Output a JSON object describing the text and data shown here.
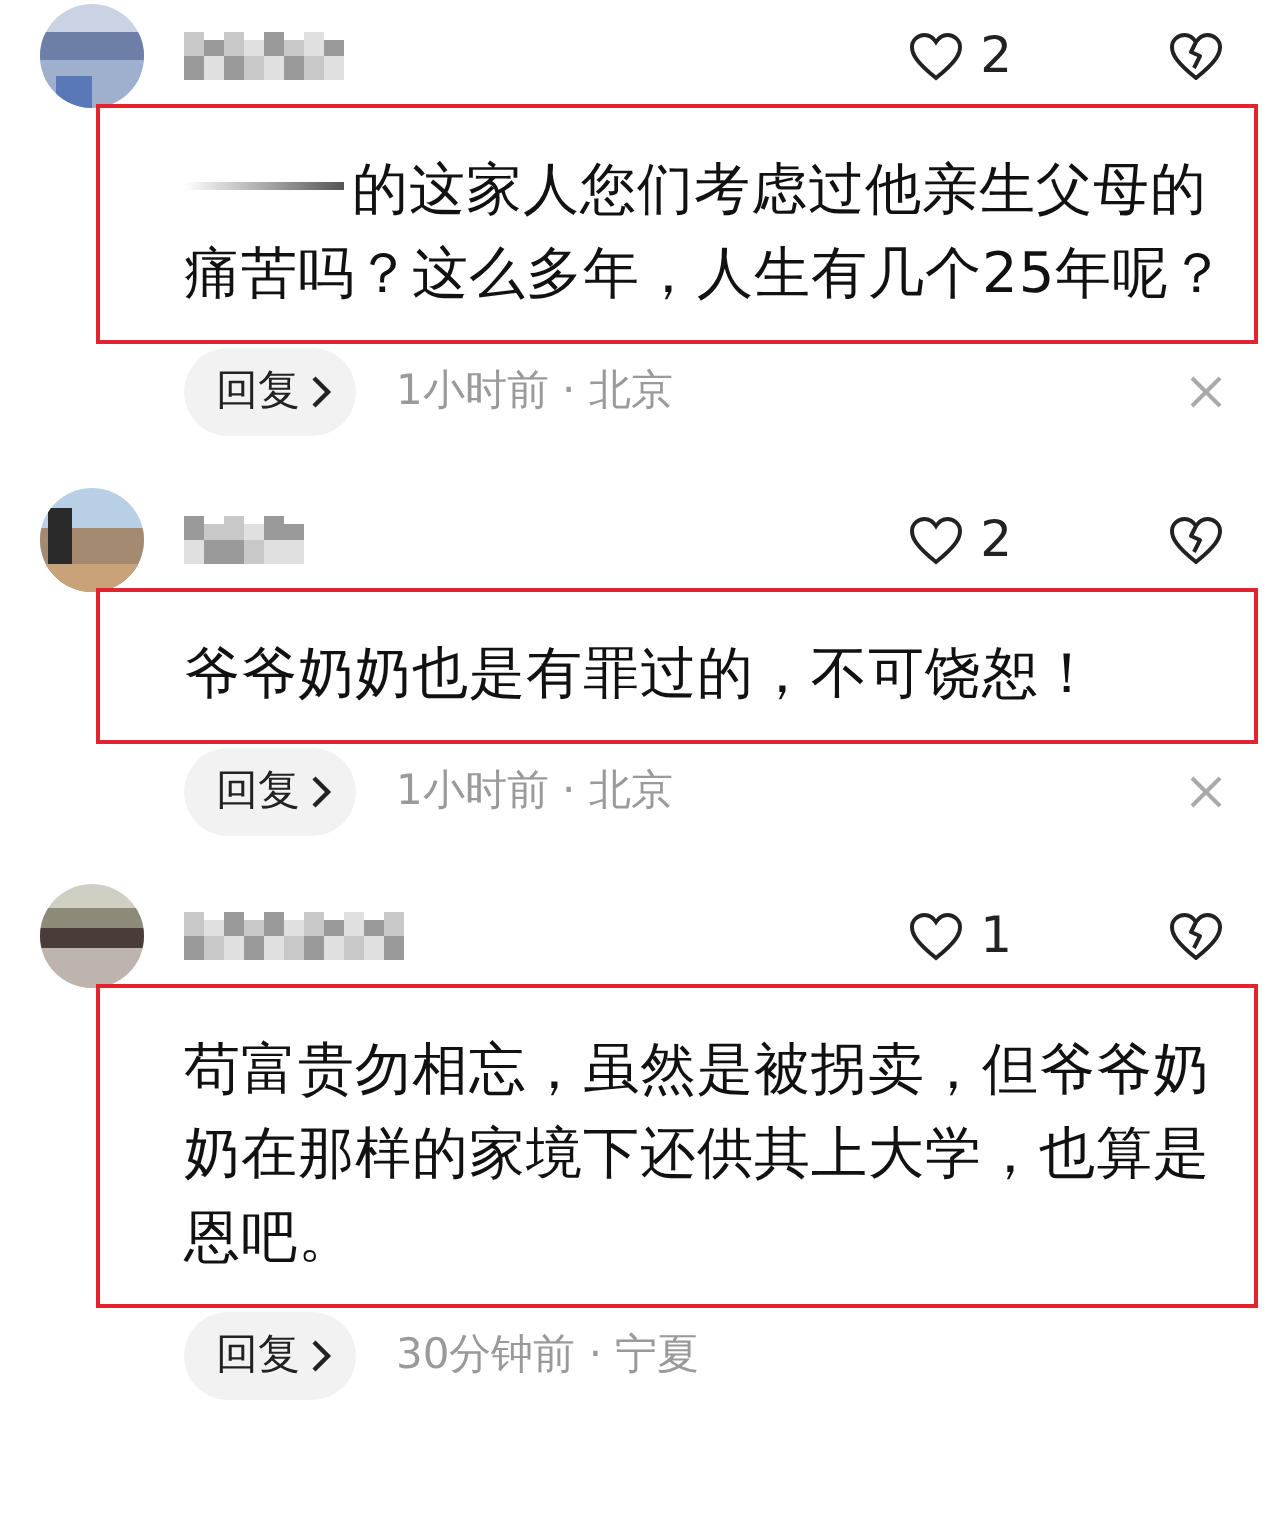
{
  "comments": [
    {
      "likes": "2",
      "redacted_prefix": true,
      "text": "的这家人您们考虑过他亲生父母的痛苦吗？这么多年，人生有几个25年呢？",
      "highlighted": true,
      "reply_label": "回复",
      "meta": "1小时前 · 北京",
      "dismissable": true
    },
    {
      "likes": "2",
      "redacted_prefix": false,
      "text": "爷爷奶奶也是有罪过的，不可饶恕！",
      "highlighted": true,
      "reply_label": "回复",
      "meta": "1小时前 · 北京",
      "dismissable": true
    },
    {
      "likes": "1",
      "redacted_prefix": false,
      "text": "苟富贵勿相忘，虽然是被拐卖，但爷爷奶奶在那样的家境下还供其上大学，也算是恩吧。",
      "highlighted": true,
      "reply_label": "回复",
      "meta": "30分钟前 · 宁夏",
      "dismissable": false
    }
  ]
}
